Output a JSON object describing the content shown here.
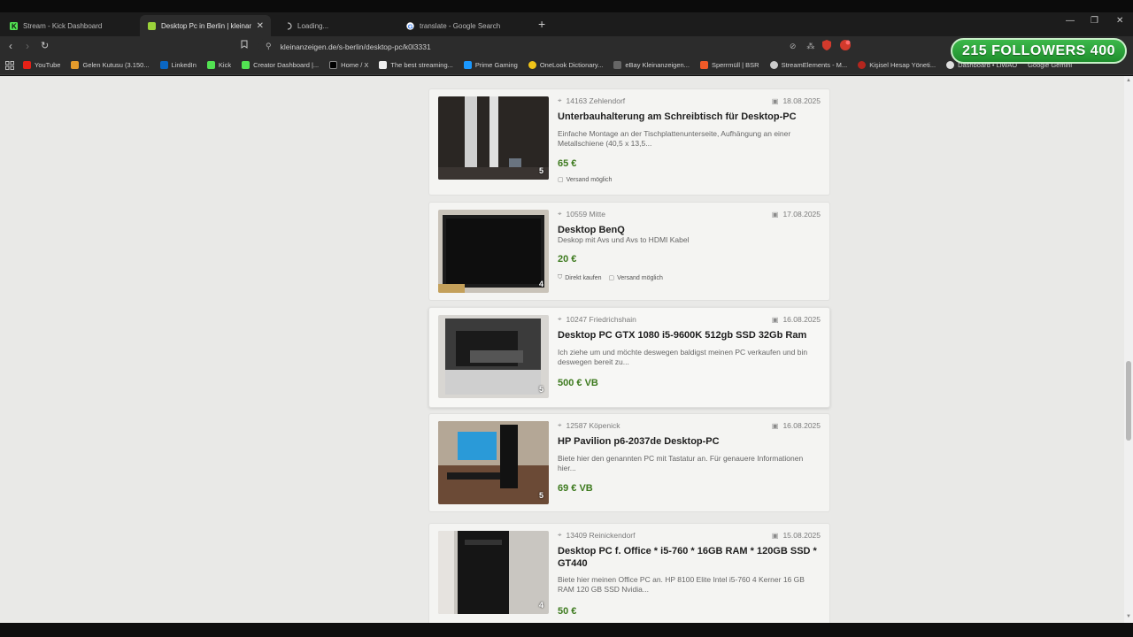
{
  "colors": {
    "price": "#3d7a1e",
    "accent": "#52e252",
    "followers_badge": "#2aa83a"
  },
  "tabs": [
    {
      "title": "Stream - Kick Dashboard",
      "icon": "kick-icon"
    },
    {
      "title": "Desktop Pc in Berlin | kleinanzeig",
      "icon": "kleinanzeigen-icon",
      "active": true
    },
    {
      "title": "Loading...",
      "icon": "loading-icon"
    },
    {
      "title": "translate - Google Search",
      "icon": "google-icon"
    }
  ],
  "toolbar": {
    "url": "kleinanzeigen.de/s-berlin/desktop-pc/k0l3331"
  },
  "bookmarks": [
    "YouTube",
    "Gelen Kutusu (3.150...",
    "LinkedIn",
    "Kick",
    "Creator Dashboard |...",
    "Home / X",
    "The best streaming...",
    "Prime Gaming",
    "OneLook Dictionary...",
    "eBay Kleinanzeigen...",
    "Sperrmüll | BSR",
    "StreamElements - M...",
    "Kişisel Hesap Yöneti...",
    "Dashboard • LiWAO",
    "Google Gemini"
  ],
  "overlay": {
    "followers": "215 FOLLOWERS 400"
  },
  "listings": [
    {
      "location": "14163 Zehlendorf",
      "date": "18.08.2025",
      "title": "Unterbauhalterung am Schreibtisch für Desktop-PC",
      "description": "Einfache Montage an der Tischplattenunterseite, Aufhängung an einer Metallschiene (40,5 x 13,5...",
      "price": "65 €",
      "image_count": "5",
      "tags": [
        "Versand möglich"
      ]
    },
    {
      "location": "10559 Mitte",
      "date": "17.08.2025",
      "title": "Desktop BenQ",
      "description": "Deskop mit Avs und Avs to HDMI Kabel",
      "price": "20 €",
      "image_count": "4",
      "tags": [
        "Direkt kaufen",
        "Versand möglich"
      ]
    },
    {
      "location": "10247 Friedrichshain",
      "date": "16.08.2025",
      "title": "Desktop PC GTX 1080 i5-9600K 512gb SSD 32Gb Ram",
      "description": "Ich ziehe um und möchte deswegen baldigst meinen PC verkaufen und bin deswegen bereit zu...",
      "price": "500 € VB",
      "image_count": "5",
      "tags": []
    },
    {
      "location": "12587 Köpenick",
      "date": "16.08.2025",
      "title": "HP Pavilion p6-2037de Desktop-PC",
      "description": "Biete hier den genannten PC mit Tastatur an. Für genauere Informationen hier...",
      "price": "69 € VB",
      "image_count": "5",
      "tags": []
    },
    {
      "location": "13409 Reinickendorf",
      "date": "15.08.2025",
      "title": "Desktop PC f. Office * i5-760 * 16GB RAM * 120GB SSD * GT440",
      "description": "Biete hier meinen Office PC an. HP 8100 Elite Intel i5-760 4 Kerner 16 GB RAM 120 GB SSD Nvidia...",
      "price": "50 €",
      "image_count": "4",
      "tags": []
    }
  ]
}
